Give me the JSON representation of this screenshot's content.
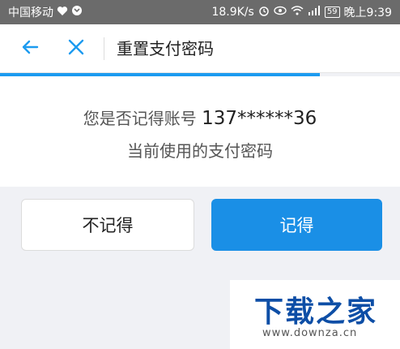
{
  "status_bar": {
    "carrier": "中国移动",
    "speed": "18.9K/s",
    "signal_label": "²⁶",
    "battery": "59",
    "time": "晚上9:39"
  },
  "nav": {
    "back_icon": "arrow-left-icon",
    "close_icon": "close-icon",
    "title": "重置支付密码",
    "accent_color": "#1c9bf0"
  },
  "progress": {
    "value_percent": 80
  },
  "prompt": {
    "prefix": "您是否记得账号",
    "account": "137******36",
    "line2": "当前使用的支付密码"
  },
  "buttons": {
    "forget_label": "不记得",
    "remember_label": "记得",
    "remember_color": "#1a8fe6"
  },
  "watermark": {
    "title": "下载之家",
    "url": "www.downza.cn"
  }
}
